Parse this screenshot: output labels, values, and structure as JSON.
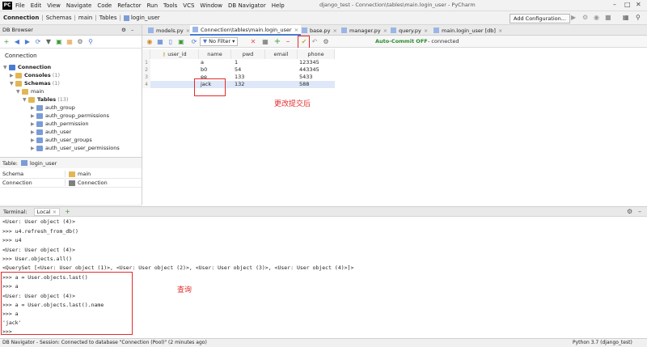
{
  "menu": {
    "items": [
      "File",
      "Edit",
      "View",
      "Navigate",
      "Code",
      "Refactor",
      "Run",
      "Tools",
      "VCS",
      "Window",
      "DB Navigator",
      "Help"
    ],
    "window_title": "django_test - Connection\\tables\\main.login_user - PyCharm"
  },
  "nav": {
    "breadcrumbs": [
      "Connection",
      "Schemas",
      "main",
      "Tables",
      "login_user"
    ],
    "config_button": "Add Configuration..."
  },
  "left_panel": {
    "title": "DB Browser",
    "tree_title": "Connection",
    "tree": [
      {
        "label": "Connection",
        "count": ""
      },
      {
        "label": "Consoles",
        "count": "(1)"
      },
      {
        "label": "Schemas",
        "count": "(1)"
      },
      {
        "label": "main",
        "count": ""
      },
      {
        "label": "Tables",
        "count": "(13)"
      },
      {
        "label": "auth_group",
        "count": ""
      },
      {
        "label": "auth_group_permissions",
        "count": ""
      },
      {
        "label": "auth_permission",
        "count": ""
      },
      {
        "label": "auth_user",
        "count": ""
      },
      {
        "label": "auth_user_groups",
        "count": ""
      },
      {
        "label": "auth_user_user_permissions",
        "count": ""
      }
    ],
    "table_label": "Table:",
    "table_name": "login_user",
    "props": [
      {
        "key": "Schema",
        "value": "main"
      },
      {
        "key": "Connection",
        "value": "Connection"
      }
    ]
  },
  "tabs": [
    {
      "label": "models.py",
      "active": false
    },
    {
      "label": "Connection\\tables\\main.login_user",
      "active": true
    },
    {
      "label": "base.py",
      "active": false
    },
    {
      "label": "manager.py",
      "active": false
    },
    {
      "label": "query.py",
      "active": false
    },
    {
      "label": "main.login_user [db]",
      "active": false
    }
  ],
  "db_toolbar": {
    "filter": "No Filter",
    "autocommit": "Auto-Commit OFF",
    "connected": "- connected"
  },
  "grid": {
    "columns": [
      "user_id",
      "name",
      "pwd",
      "email",
      "phone"
    ],
    "rows": [
      {
        "num": "1",
        "user_id": "",
        "name": "a",
        "pwd": "1",
        "email": "",
        "phone": "123345"
      },
      {
        "num": "2",
        "user_id": "",
        "name": "b0",
        "pwd": "54",
        "email": "",
        "phone": "443345"
      },
      {
        "num": "3",
        "user_id": "",
        "name": "ee",
        "pwd": "133",
        "email": "",
        "phone": "5433"
      },
      {
        "num": "4",
        "user_id": "",
        "name": "jack",
        "pwd": "132",
        "email": "",
        "phone": "588"
      }
    ],
    "annotation": "更改提交后"
  },
  "terminal": {
    "title": "Terminal:",
    "tab": "Local",
    "lines": [
      "<User: User object (4)>",
      ">>> u4.refresh_from_db()",
      ">>> u4",
      "<User: User object (4)>",
      ">>> User.objects.all()",
      "<QuerySet [<User: User object (1)>, <User: User object (2)>, <User: User object (3)>, <User: User object (4)>]>",
      ">>> a = User.objects.last()",
      ">>> a",
      "<User: User object (4)>",
      ">>> a = User.objects.last().name",
      ">>> a",
      "'jack'",
      ">>>"
    ],
    "annotation": "查询"
  },
  "status": {
    "left": "DB Navigator - Session: Connected to database \"Connection (Pool)\" (2 minutes ago)",
    "right": "Python 3.7 (django_test)"
  },
  "colors": {
    "accent": "#4a7bd1",
    "annotation": "#e32b2b",
    "autocommit": "#2f8a2f"
  }
}
